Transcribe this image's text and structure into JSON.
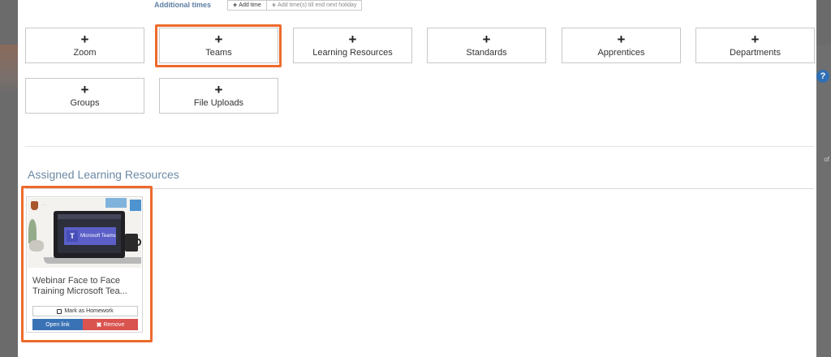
{
  "additional_times": {
    "label": "Additional times",
    "add_time": "Add time",
    "add_till_holiday": "Add time(s) till end next holiday"
  },
  "tiles": [
    {
      "plus": "+",
      "label": "Zoom"
    },
    {
      "plus": "+",
      "label": "Teams"
    },
    {
      "plus": "+",
      "label": "Learning Resources"
    },
    {
      "plus": "+",
      "label": "Standards"
    },
    {
      "plus": "+",
      "label": "Apprentices"
    },
    {
      "plus": "+",
      "label": "Departments"
    },
    {
      "plus": "+",
      "label": "Groups"
    },
    {
      "plus": "+",
      "label": "File Uploads"
    }
  ],
  "assigned": {
    "title": "Assigned Learning Resources",
    "card": {
      "thumbnail_banner": "Microsoft Teams",
      "thumbnail_logo_letter": "T",
      "title_line1": "Webinar Face to Face",
      "title_line2": "Training Microsoft Tea...",
      "homework_label": "Mark as Homework",
      "open_label": "Open link",
      "remove_label": "Remove"
    }
  },
  "help_badge": "?",
  "colors": {
    "highlight": "#ee6a2c",
    "open_button": "#3a72b6",
    "remove_button": "#d9534f",
    "section_title": "#6c8aa6"
  }
}
